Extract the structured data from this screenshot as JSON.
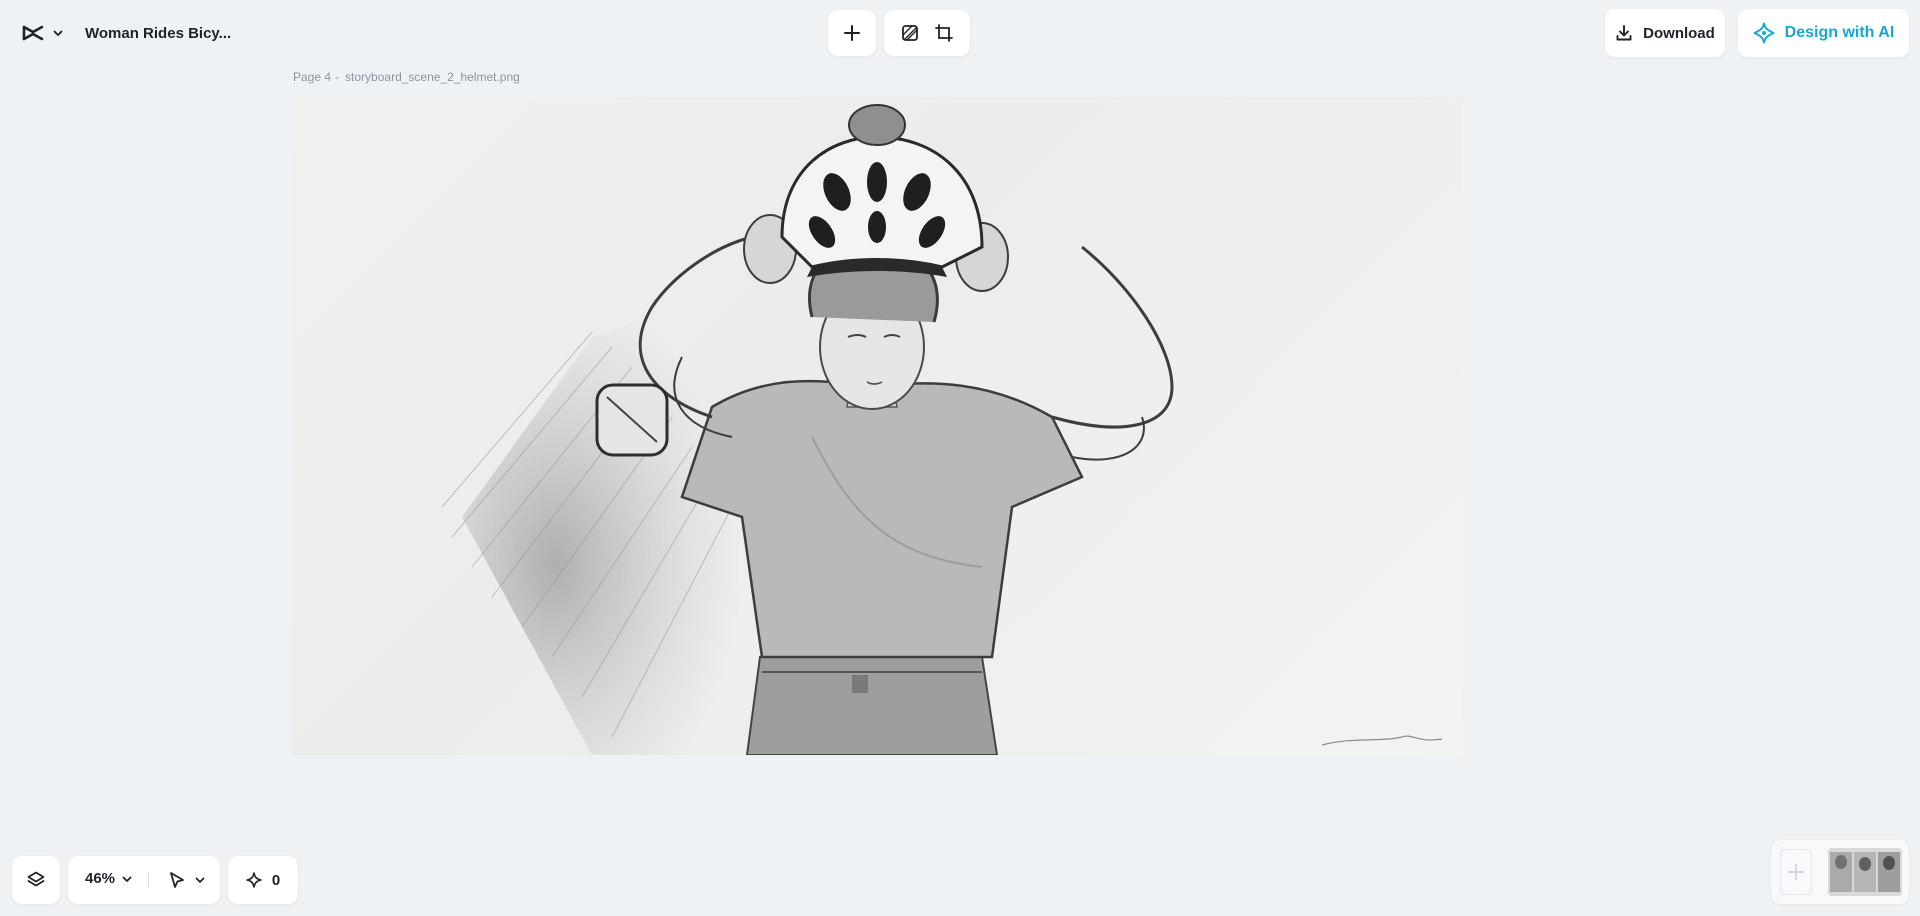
{
  "header": {
    "document_title": "Woman Rides Bicy...",
    "download_label": "Download",
    "ai_label": "Design with AI",
    "accent_color": "#17a7d6"
  },
  "icons": {
    "logo": "capcut-logo-icon",
    "dropdown": "chevron-down-icon",
    "add": "plus-icon",
    "remove_bg": "remove-background-icon",
    "resize": "resize-icon",
    "download": "download-icon",
    "ai": "ai-sparkle-icon",
    "layers": "layers-icon",
    "pointer": "pointer-icon",
    "magic": "sparkle-icon"
  },
  "canvas": {
    "page_label": "Page 4",
    "separator": "-",
    "file_name": "storyboard_scene_2_helmet.png"
  },
  "footer": {
    "zoom_value": "46%",
    "magic_count": "0"
  }
}
